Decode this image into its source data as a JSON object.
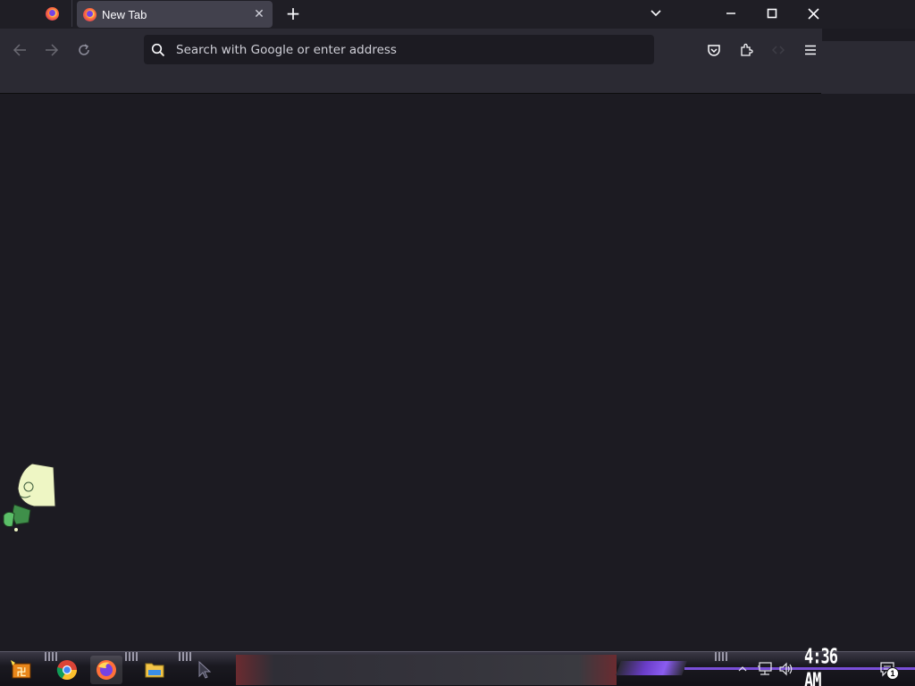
{
  "browser": {
    "active_tab_title": "New Tab",
    "close_tab_glyph": "✕",
    "new_tab_glyph": "+",
    "address_placeholder": "Search with Google or enter address",
    "address_value": ""
  },
  "window_controls": {
    "minimize": "minimize-icon",
    "maximize": "maximize-icon",
    "close": "close-icon"
  },
  "toolbar_icons": [
    "back-arrow-icon",
    "forward-arrow-icon",
    "reload-icon",
    "pocket-icon",
    "extensions-icon",
    "app-menu-icon"
  ],
  "taskbar": {
    "pinned_apps": [
      "start-icon",
      "chrome-icon",
      "firefox-icon",
      "file-explorer-icon",
      "cursor-icon"
    ],
    "clock": "4:36 AM",
    "notification_count": "1"
  },
  "colors": {
    "background": "#1c1b22",
    "toolbar": "#2b2a33",
    "active_tab": "#42414d",
    "accent_purple": "#7a4fd8"
  }
}
